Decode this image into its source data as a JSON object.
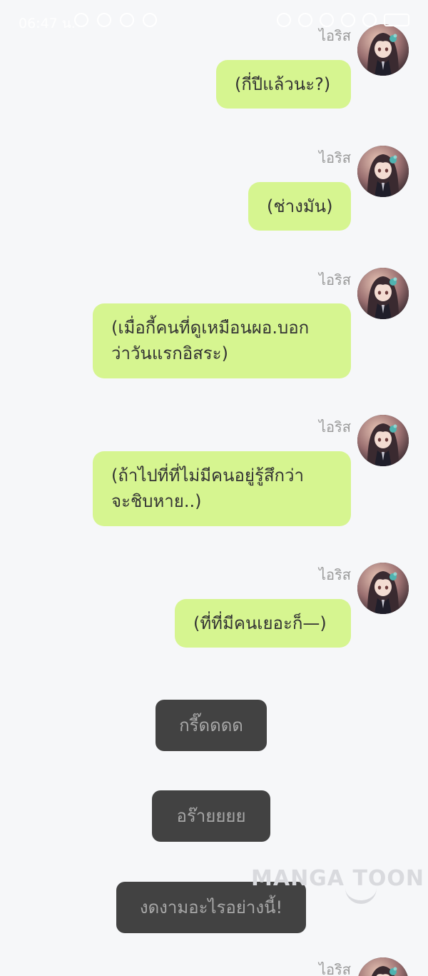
{
  "status_bar": {
    "time": "06:47 น.",
    "left_icons": [
      "messenger-icon",
      "headphones-icon",
      "chat-icon",
      "play-icon"
    ],
    "right_icons": [
      "alarm-icon",
      "mute-icon",
      "signal-icon",
      "wifi-icon",
      "sim-icon",
      "battery-icon"
    ]
  },
  "messages": [
    {
      "sender": "ไอริส",
      "text": "(กี่ปีแล้วนะ?)"
    },
    {
      "sender": "ไอริส",
      "text": "(ช่างมัน)"
    },
    {
      "sender": "ไอริส",
      "text": "(เมื่อกี้คนที่ดูเหมือนผอ.บอก\nว่าวันแรกอิสระ)"
    },
    {
      "sender": "ไอริส",
      "text": "(ถ้าไปที่ที่ไม่มีคนอยู่รู้สึกว่า\nจะชิบหาย..)"
    },
    {
      "sender": "ไอริส",
      "text": "(ที่ที่มีคนเยอะก็—)"
    },
    {
      "sender": "ไอริส",
      "text": ""
    }
  ],
  "choices": [
    {
      "label": "กรี๊ดดดด"
    },
    {
      "label": "อร๊ายยยย"
    },
    {
      "label": "งดงามอะไรอย่างนี้!"
    }
  ],
  "watermark": "MANGA TOON",
  "colors": {
    "background": "#f6f7f9",
    "bubble": "#d6f590",
    "bubble_text": "#333333",
    "choice_bg": "#424242",
    "choice_text": "#a7a7a7",
    "sender_name": "#9a9a9a"
  }
}
